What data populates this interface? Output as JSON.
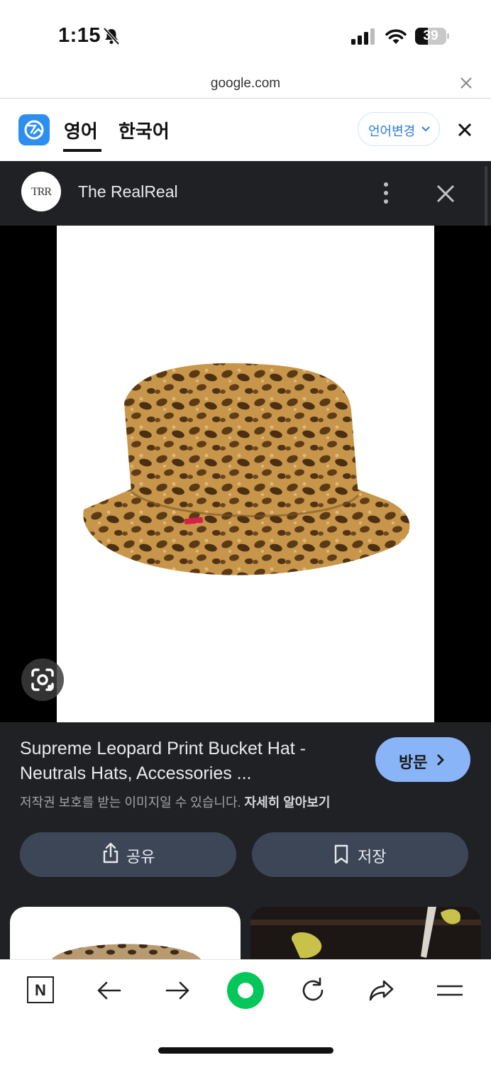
{
  "status_bar": {
    "time": "1:15",
    "battery": "39",
    "icons": [
      "bell-slash-icon",
      "cellular-signal-icon",
      "wifi-icon",
      "battery-icon"
    ]
  },
  "browser": {
    "url": "google.com"
  },
  "translation_bar": {
    "source_lang": "영어",
    "target_lang": "한국어",
    "change_language": "언어변경",
    "active_tab": "source_lang"
  },
  "viewer": {
    "source": {
      "logo_text": "TRR",
      "name": "The RealReal"
    },
    "title_line1": "Supreme Leopard Print Bucket Hat -",
    "title_line2": "Neutrals Hats, Accessories ...",
    "visit_label": "방문",
    "copyright_notice": "저작권 보호를 받는 이미지일 수 있습니다.",
    "learn_more": "자세히 알아보기",
    "share_label": "공유",
    "save_label": "저장"
  },
  "toolbar": {
    "items": [
      "naver-home-icon",
      "back-arrow-icon",
      "forward-arrow-icon",
      "green-dot-icon",
      "reload-icon",
      "share-icon",
      "menu-icon"
    ],
    "naver_letter": "N"
  },
  "colors": {
    "viewer_bg": "#202124",
    "visit_button": "#8ab4f8",
    "action_button": "#3c4657",
    "accent_blue": "#2a7de1",
    "naver_green": "#03c75a"
  }
}
